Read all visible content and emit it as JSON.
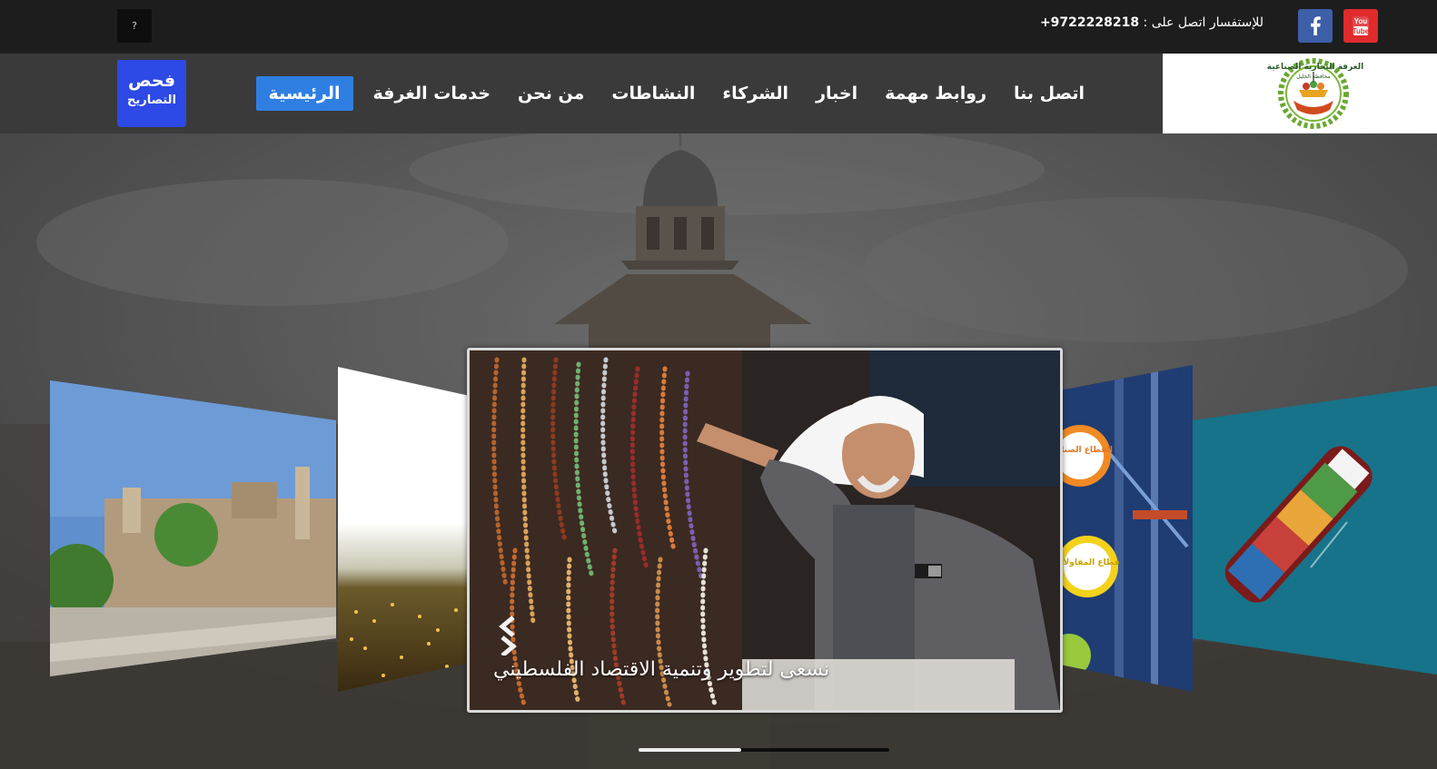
{
  "topbar": {
    "social_youtube_label": "You\nTube",
    "phone_prefix": "للإستفسار اتصل على : ",
    "phone_number": "+9722228218",
    "small_button_glyph": "?"
  },
  "nav": {
    "items": [
      {
        "label": "الرئيسية",
        "active": true
      },
      {
        "label": "خدمات الغرفة",
        "active": false
      },
      {
        "label": "من نحن",
        "active": false
      },
      {
        "label": "النشاطات",
        "active": false
      },
      {
        "label": "الشركاء",
        "active": false
      },
      {
        "label": "اخبار",
        "active": false
      },
      {
        "label": "روابط مهمة",
        "active": false
      },
      {
        "label": "اتصل بنا",
        "active": false
      }
    ],
    "check_button": {
      "line1": "فحص",
      "line2": "التصاريح"
    }
  },
  "logo": {
    "text_line1": "الغرفة التجارية الصناعية",
    "text_line2": "محافظة الخليل",
    "text_line3": "جنوب"
  },
  "hero": {
    "caption": "نسعى لتطوير وتنمية الاقتصاد الفلسطيني",
    "side_slide_labels": [
      "القطاع الصناعي",
      "قطاع المقاولات"
    ],
    "progress": 0.41
  },
  "colors": {
    "active_nav": "#2f7fe3",
    "check_button": "#2d49e6",
    "youtube": "#e02a2c",
    "facebook": "#3d5fa8"
  }
}
